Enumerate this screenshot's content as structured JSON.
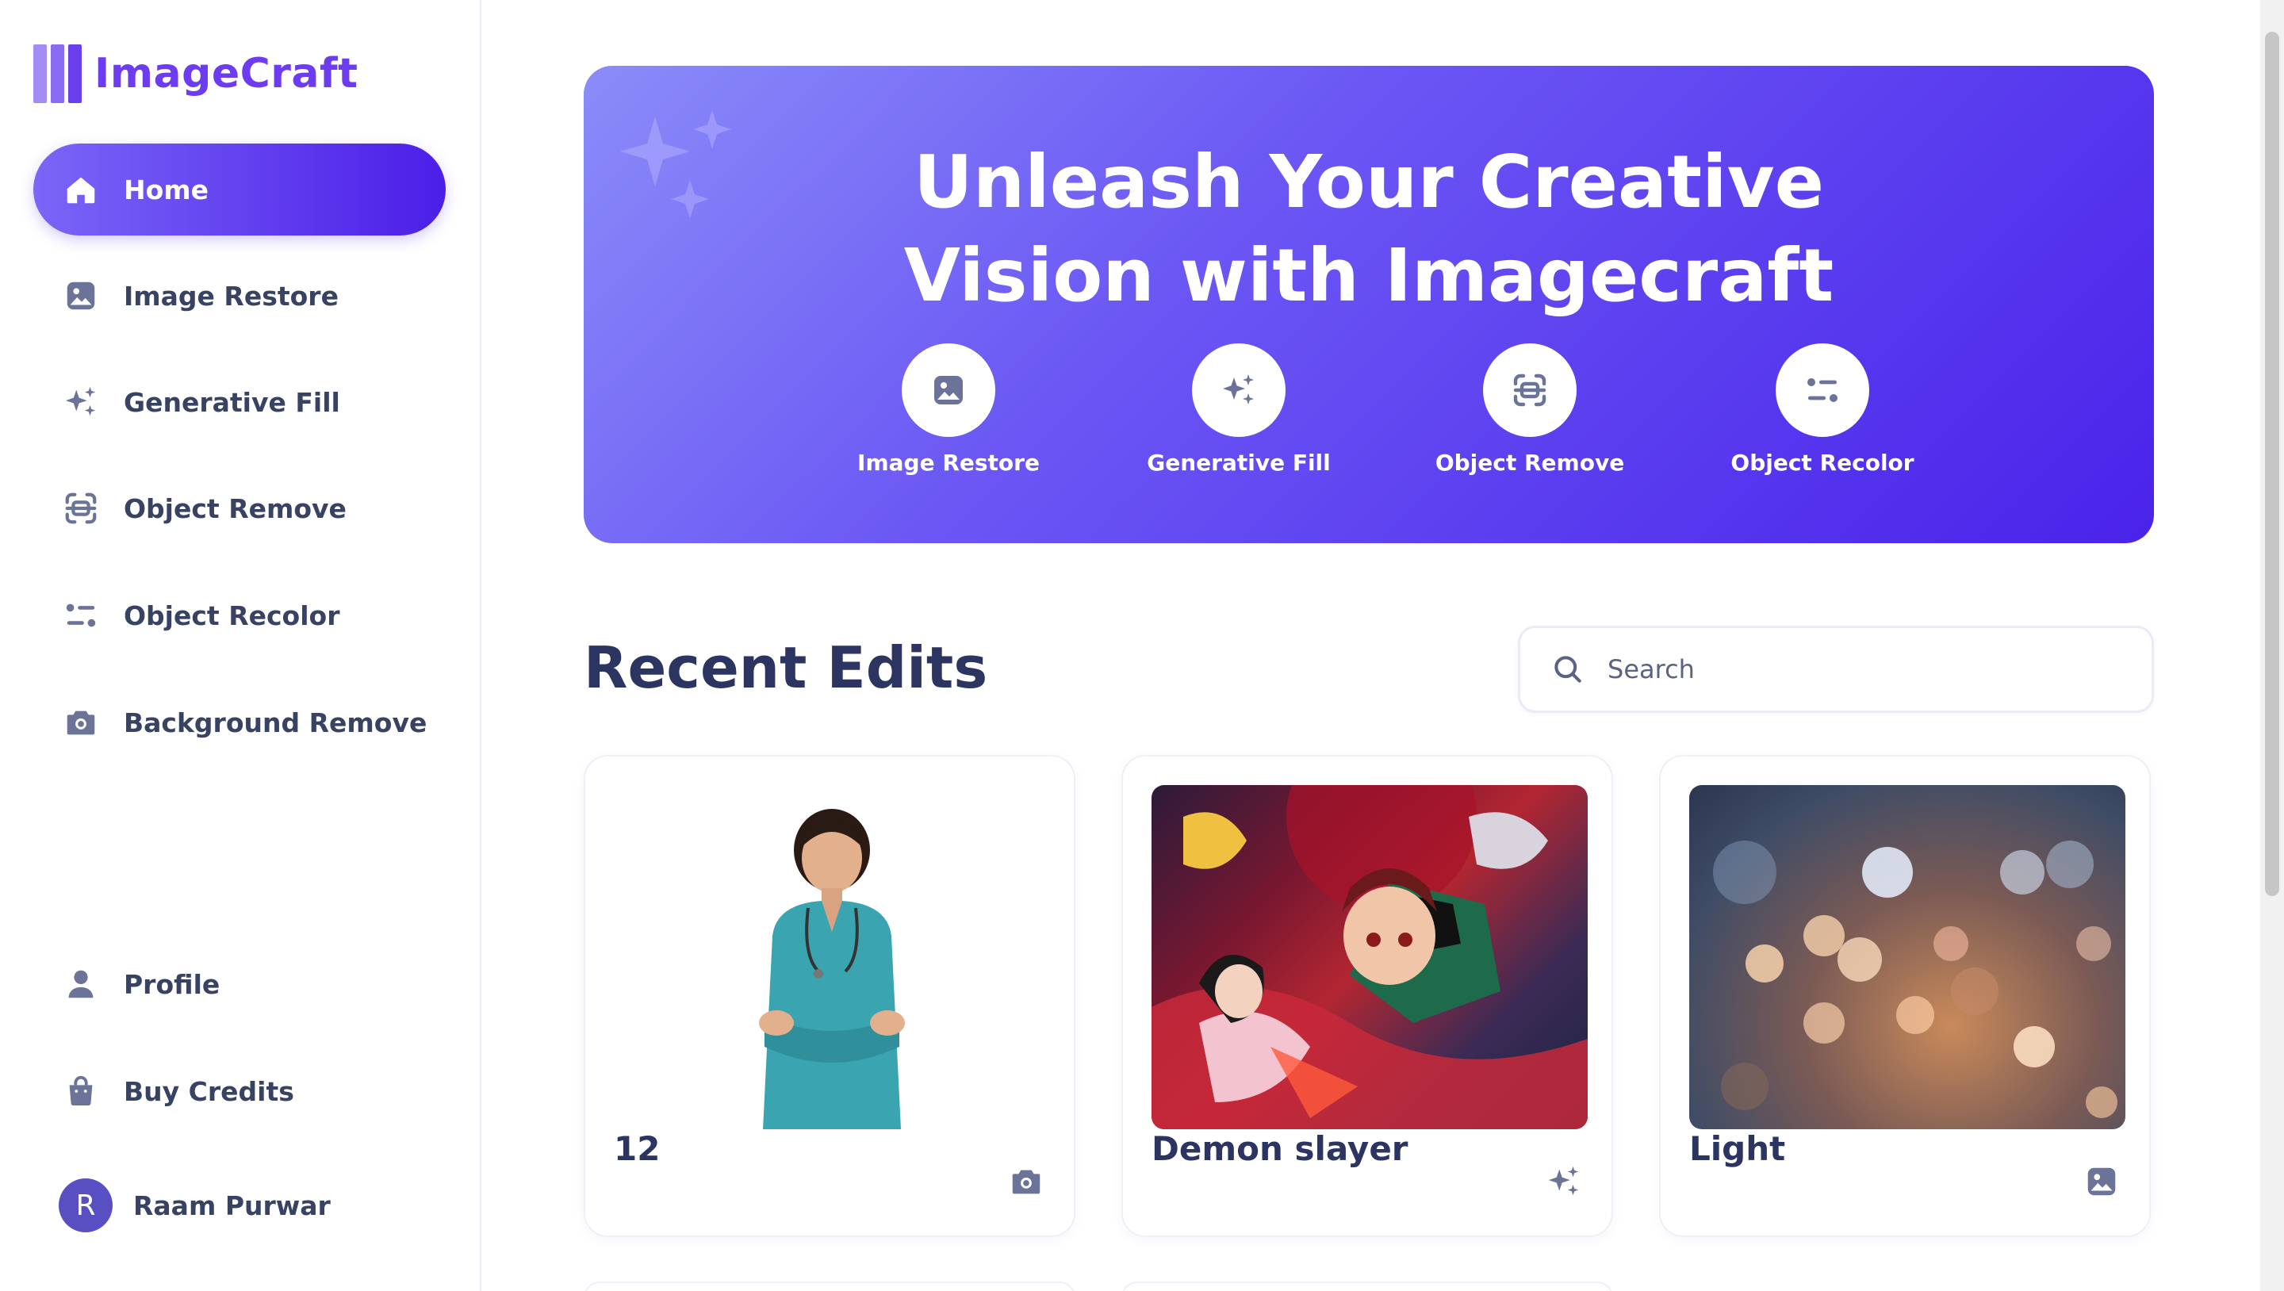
{
  "app": {
    "name": "ImageCraft"
  },
  "sidebar": {
    "nav": [
      {
        "label": "Home",
        "icon": "home-icon",
        "active": true
      },
      {
        "label": "Image Restore",
        "icon": "image-icon",
        "active": false
      },
      {
        "label": "Generative Fill",
        "icon": "sparkles-icon",
        "active": false
      },
      {
        "label": "Object Remove",
        "icon": "scan-icon",
        "active": false
      },
      {
        "label": "Object Recolor",
        "icon": "filter-icon",
        "active": false
      },
      {
        "label": "Background Remove",
        "icon": "camera-icon",
        "active": false
      }
    ],
    "bottom": [
      {
        "label": "Profile",
        "icon": "user-icon"
      },
      {
        "label": "Buy Credits",
        "icon": "bag-icon"
      }
    ],
    "user": {
      "initial": "R",
      "name": "Raam Purwar"
    }
  },
  "hero": {
    "title_line1": "Unleash Your Creative",
    "title_line2": "Vision with Imagecraft",
    "features": [
      {
        "label": "Image Restore",
        "icon": "image-icon"
      },
      {
        "label": "Generative Fill",
        "icon": "sparkles-icon"
      },
      {
        "label": "Object Remove",
        "icon": "scan-icon"
      },
      {
        "label": "Object Recolor",
        "icon": "filter-icon"
      }
    ]
  },
  "recent": {
    "title": "Recent Edits",
    "search_placeholder": "Search",
    "cards": [
      {
        "title": "12",
        "icon": "camera-icon"
      },
      {
        "title": "Demon slayer",
        "icon": "sparkles-icon"
      },
      {
        "title": "Light",
        "icon": "image-icon"
      }
    ]
  },
  "colors": {
    "accent": "#5b2ef0",
    "accent_light": "#7b70f6",
    "text": "#384262",
    "heading": "#2c3561",
    "icon": "#6b7398"
  }
}
